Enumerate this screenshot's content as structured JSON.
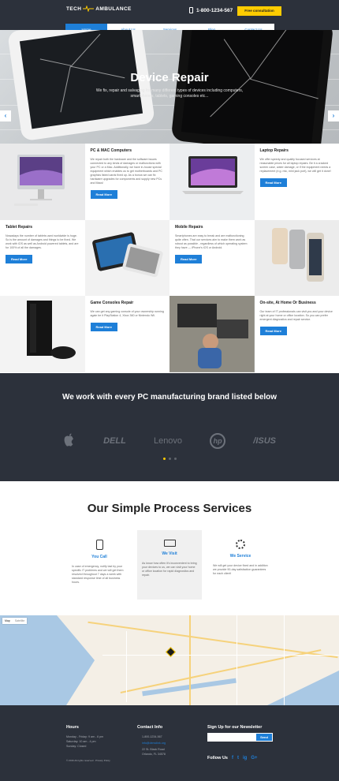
{
  "header": {
    "logo_left": "TECH",
    "logo_right": "AMBULANCE",
    "phone": "1-800-1234-567",
    "consult_button": "Free consultation",
    "nav": [
      "Home",
      "About Us",
      "Services",
      "Blog",
      "Contact Us"
    ],
    "active_nav": "Home"
  },
  "hero": {
    "title": "Device Repair",
    "subtitle": "We fix, repair and salvaging for many different types of devices including computers, smartphones, tablets, gaming consoles etc...",
    "prev": "‹",
    "next": "›"
  },
  "services": [
    {
      "title": "PC & MAC Computers",
      "text": "We repair both the hardware and the software issues connected to any kinds of damages or malfunctions with your PC or a Mac. Additionally, we have in-house special equipment which enables us to get motherboards and PC graphics listed cards fixed up. As a bonus we can fix hardware upgrades for components and supply new PCs and Macs!",
      "button": "Read More"
    },
    {
      "title": "Laptop Repairs",
      "text": "We offer speedy and quality focused services at reasonable prices for all laptop repairs. Be it a cracked screen case, water damage, or if the equipment needs a replacement (e.g. mic, mini jack port), we will get it done!",
      "button": "Read More"
    },
    {
      "title": "Tablet Repairs",
      "text": "Nowadays the number of tablets used worldwide is huge. So is the amount of damages and things to be fixed. We work with iOS as well as Android powered tablets, and are for 100% of all the damages.",
      "button": "Read More"
    },
    {
      "title": "Mobile Repairs",
      "text": "Smartphones are easy to break and are malfunctioning quite often. That our services aim to make them work as robust as possible - regardless of which operating system they have — iPhone's iOS or Android.",
      "button": "Read More"
    },
    {
      "title": "Game Consoles Repair",
      "text": "We can get any gaming console of your ownership running again be it PlayStation 4, Xbox 360 or Nintendo Wii.",
      "button": "Read More"
    },
    {
      "title": "On-site, At Home Or Business",
      "text": "Our team of IT professionals can visit you and your device right at your home or office location. So you can prefer emergent diagnostics and repair service.",
      "button": "Read More"
    }
  ],
  "brands": {
    "heading": "We work with every PC manufacturing brand listed below",
    "logos": [
      "",
      "DELL",
      "Lenovo",
      "hp",
      "/ISUS"
    ]
  },
  "process": {
    "heading": "Our Simple Process Services",
    "steps": [
      {
        "title": "You Call",
        "text": "In case of emergency, notify last by your specific IT problems and we will get them resolved throughout 7 days a week with standard response time of all business hours."
      },
      {
        "title": "We Visit",
        "text": "As know how often it's inconvenient to bring your devices to us, we can visit your home or office location for rapid diagnostics and repair."
      },
      {
        "title": "We Service",
        "text": "We will get your device fixed and in addition we provide 90-day satisfaction guarantees for each client!"
      }
    ]
  },
  "map": {
    "map_btn": "Map",
    "sat_btn": "Satellite"
  },
  "footer": {
    "hours_title": "Hours",
    "hours": [
      "Monday - Friday: 9 am - 6 pm",
      "Saturday: 10 am - 4 pm",
      "Sunday: Closed"
    ],
    "copyright": "© 2016 All rights reserved · Privacy Policy",
    "contact_title": "Contact Info",
    "phone": "1-800-1234-567",
    "email": "info@demolink.org",
    "address1": "22 St. Black Road",
    "address2": "Orlando, FL 34578",
    "newsletter_title": "Sign Up for our Newsletter",
    "newsletter_button": "Send",
    "follow_title": "Follow Us",
    "social": [
      "f",
      "t",
      "ig",
      "G+"
    ]
  },
  "colors": {
    "accent": "#1e7fd8",
    "dark": "#2c313b",
    "yellow": "#ffcc00"
  }
}
